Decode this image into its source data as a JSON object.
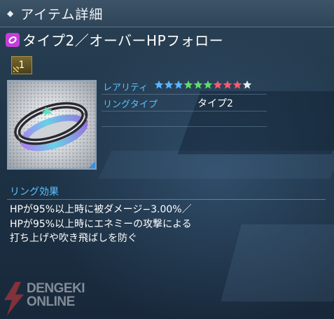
{
  "header": {
    "title": "アイテム詳細"
  },
  "item": {
    "name": "タイプ2／オーバーHPフォロー",
    "rank": "1"
  },
  "stats": {
    "rarity_label": "レアリティ",
    "rarity_stars": [
      "#5ab4ff",
      "#5ab4ff",
      "#5ab4ff",
      "#5fdc6a",
      "#5fdc6a",
      "#5fdc6a",
      "#ff5a6e",
      "#ff5a6e",
      "#ff5a6e",
      "#e8ecf0"
    ],
    "ring_type_label": "リングタイプ",
    "ring_type_value": "タイプ2"
  },
  "effect": {
    "title": "リング効果",
    "text": "HPが95%以上時に被ダメージ−3.00%／\nHPが95%以上時にエネミーの攻撃による\n打ち上げや吹き飛ばしを防ぐ"
  },
  "watermark": {
    "line1": "DENGEKI",
    "line2": "ONLINE"
  },
  "colors": {
    "accent": "#59c3ff",
    "ring_badge": "#c23fd8"
  }
}
